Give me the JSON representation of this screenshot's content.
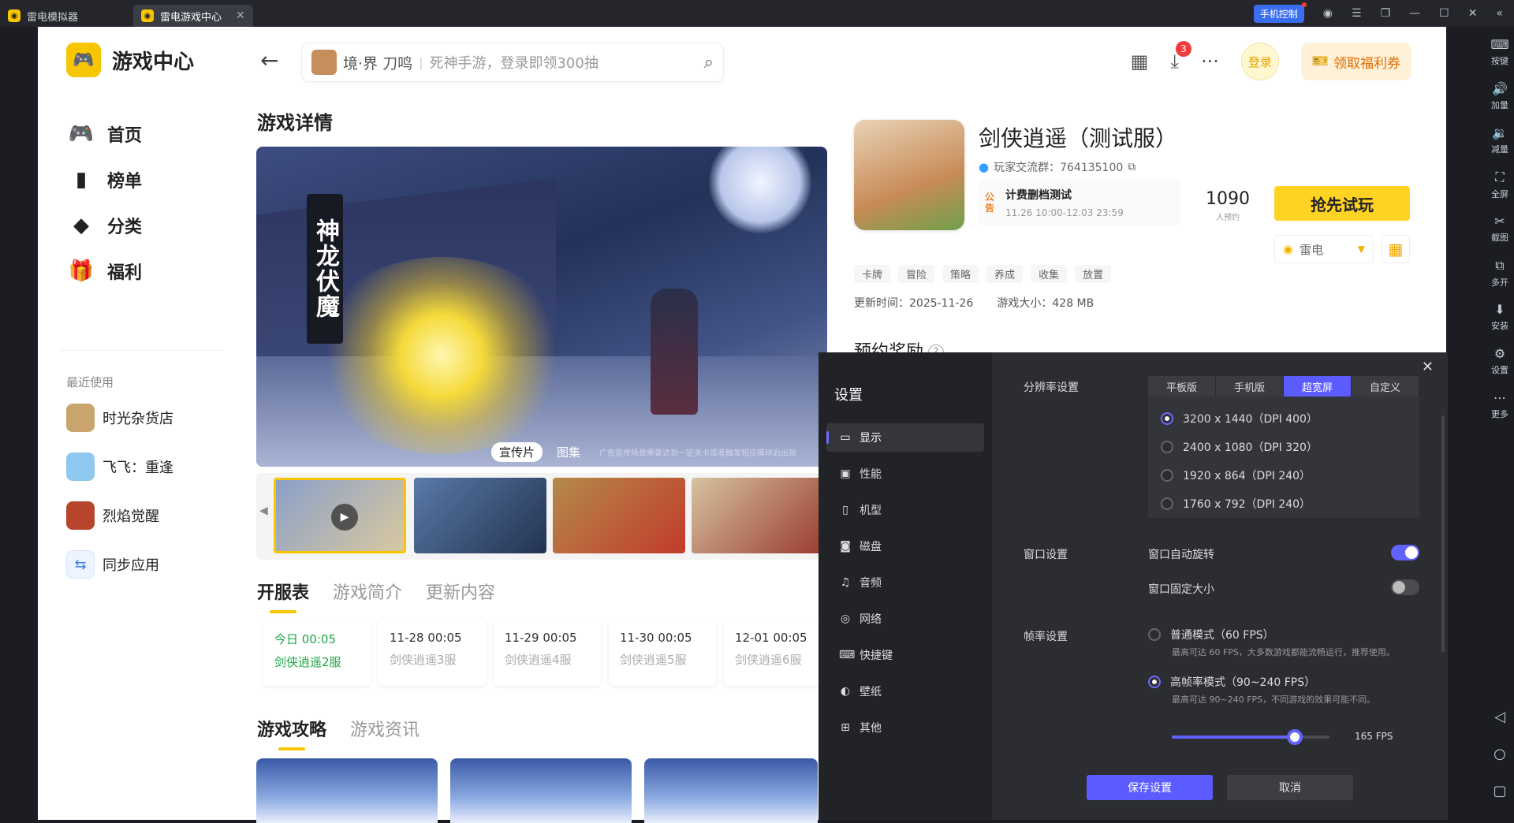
{
  "titlebar": {
    "tabs": [
      {
        "label": "雷电模拟器"
      },
      {
        "label": "雷电游戏中心"
      }
    ],
    "phone_control": "手机控制"
  },
  "sidebar": {
    "brand": "游戏中心",
    "nav": [
      {
        "label": "首页",
        "icon": "gamepad-icon"
      },
      {
        "label": "榜单",
        "icon": "chart-icon"
      },
      {
        "label": "分类",
        "icon": "category-icon"
      },
      {
        "label": "福利",
        "icon": "gift-icon"
      }
    ],
    "recent_title": "最近使用",
    "recent": [
      {
        "label": "时光杂货店",
        "color": "#c9a46c"
      },
      {
        "label": "飞飞：重逢",
        "color": "#8ec8ef"
      },
      {
        "label": "烈焰觉醒",
        "color": "#b6452c"
      },
      {
        "label": "同步应用",
        "color": "#3c7cf0"
      }
    ]
  },
  "topbar": {
    "search_game": "境·界 刀鸣",
    "search_placeholder": "死神手游，登录即领300抽",
    "download_badge": "3",
    "login": "登录",
    "welfare": "领取福利券"
  },
  "page": {
    "title": "游戏详情",
    "banner": {
      "scroll_text": "神龙伏魔",
      "tabs": [
        "宣传片",
        "图集"
      ],
      "disclaimer": "广告宣传场景需要达到一定关卡或者触发相应模块后出现"
    },
    "section_tabs": [
      "开服表",
      "游戏简介",
      "更新内容"
    ],
    "servers": [
      {
        "time": "今日 00:05",
        "name": "剑侠逍遥2服"
      },
      {
        "time": "11-28 00:05",
        "name": "剑侠逍遥3服"
      },
      {
        "time": "11-29 00:05",
        "name": "剑侠逍遥4服"
      },
      {
        "time": "11-30 00:05",
        "name": "剑侠逍遥5服"
      },
      {
        "time": "12-01 00:05",
        "name": "剑侠逍遥6服"
      }
    ],
    "guide_tabs": [
      "游戏攻略",
      "游戏资讯"
    ]
  },
  "game": {
    "name": "剑侠逍遥（测试服）",
    "group": "玩家交流群：764135100",
    "notice_tag": "公告",
    "notice_title": "计费删档测试",
    "notice_date": "11.26 10:00-12.03 23:59",
    "tags": [
      "卡牌",
      "冒险",
      "策略",
      "养成",
      "收集",
      "放置"
    ],
    "update_time": "更新时间：2025-11-26",
    "size": "游戏大小：428 MB",
    "reserve_count": "1090",
    "reserve_label": "人预约",
    "play_button": "抢先试玩",
    "download_source": "雷电",
    "reward_title": "预约奖励"
  },
  "dialog": {
    "title": "设置",
    "menu": [
      {
        "label": "显示",
        "icon": "monitor-icon"
      },
      {
        "label": "性能",
        "icon": "performance-icon"
      },
      {
        "label": "机型",
        "icon": "device-icon"
      },
      {
        "label": "磁盘",
        "icon": "disk-icon"
      },
      {
        "label": "音频",
        "icon": "audio-icon"
      },
      {
        "label": "网络",
        "icon": "network-icon"
      },
      {
        "label": "快捷键",
        "icon": "keyboard-icon"
      },
      {
        "label": "壁纸",
        "icon": "palette-icon"
      },
      {
        "label": "其他",
        "icon": "grid-icon"
      }
    ],
    "resolution_label": "分辨率设置",
    "resolution_tabs": [
      "平板版",
      "手机版",
      "超宽屏",
      "自定义"
    ],
    "resolutions": [
      "3200 x 1440（DPI 400）",
      "2400 x 1080（DPI 320）",
      "1920 x 864（DPI 240）",
      "1760 x 792（DPI 240）"
    ],
    "window_label": "窗口设置",
    "auto_rotate": "窗口自动旋转",
    "fixed_size": "窗口固定大小",
    "fps_label": "帧率设置",
    "fps_normal": "普通模式（60 FPS）",
    "fps_normal_desc": "最高可达 60 FPS，大多数游戏都能流畅运行，推荐使用。",
    "fps_high": "高帧率模式（90~240 FPS）",
    "fps_high_desc": "最高可达 90~240 FPS，不同游戏的效果可能不同。",
    "fps_value": "165 FPS",
    "fps_slider_fraction": 0.78,
    "save": "保存设置",
    "cancel": "取消"
  },
  "rightbar": [
    {
      "label": "按键",
      "icon": "keyboard-icon"
    },
    {
      "label": "加量",
      "icon": "volume-up-icon"
    },
    {
      "label": "减量",
      "icon": "volume-down-icon"
    },
    {
      "label": "全屏",
      "icon": "fullscreen-icon"
    },
    {
      "label": "截图",
      "icon": "scissors-icon"
    },
    {
      "label": "多开",
      "icon": "multi-icon"
    },
    {
      "label": "安装",
      "icon": "install-icon"
    },
    {
      "label": "设置",
      "icon": "settings-icon"
    },
    {
      "label": "更多",
      "icon": "more-icon"
    }
  ],
  "colors": {
    "accent": "#ffd224",
    "dialog_accent": "#5b5bff",
    "today_green": "#1fa646"
  }
}
